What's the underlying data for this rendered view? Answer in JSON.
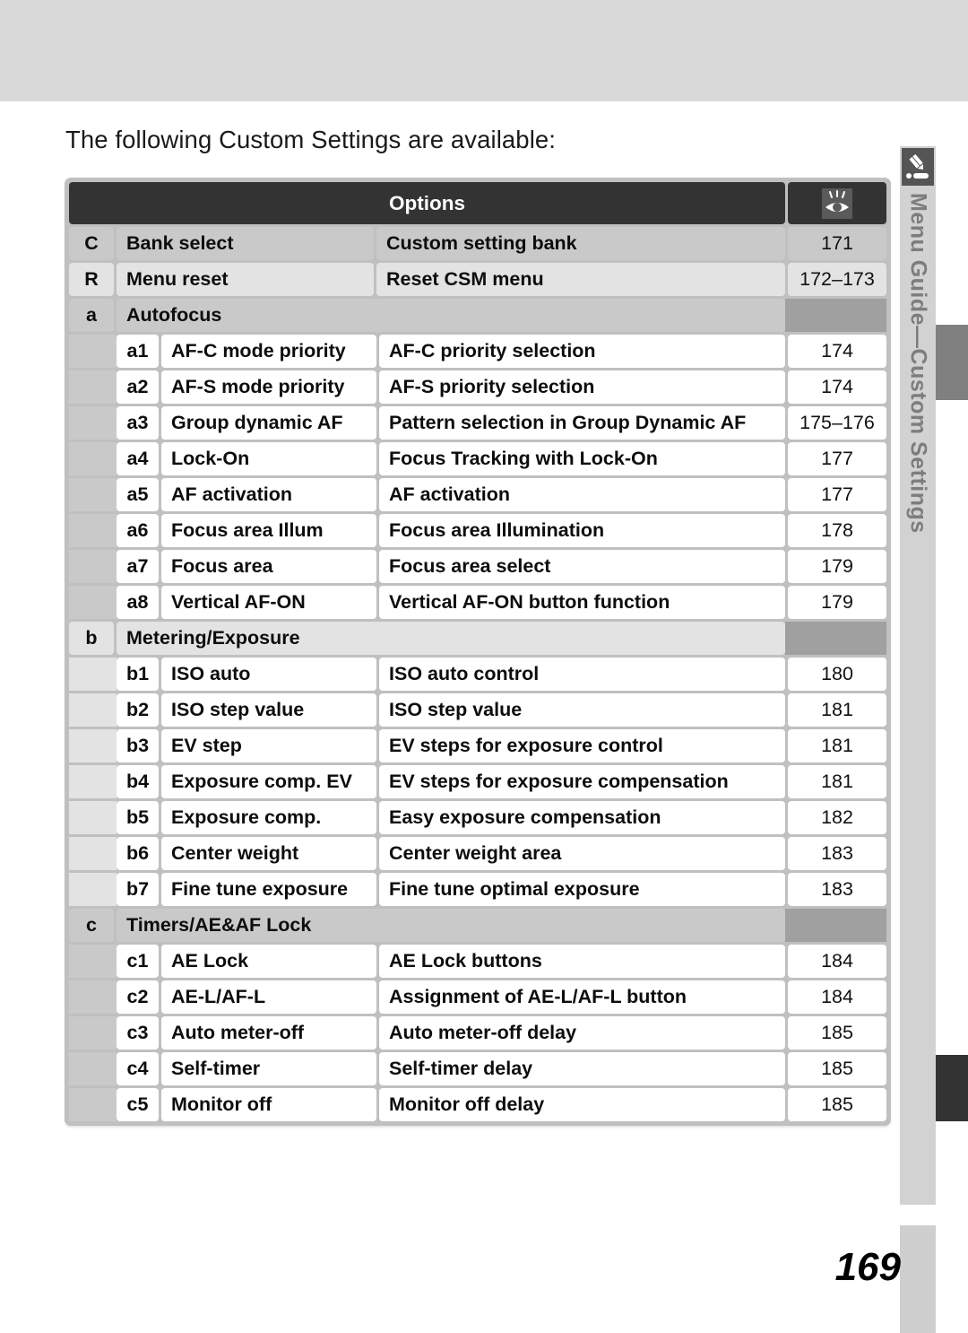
{
  "document": {
    "intro_text": "The following Custom Settings are available:",
    "page_number": "169"
  },
  "side_tab": {
    "label": "Menu Guide—Custom Settings",
    "icon": "pencil-icon"
  },
  "table": {
    "header": {
      "options_label": "Options",
      "page_icon": "eye-reference-icon"
    },
    "top_rows": [
      {
        "index": "C",
        "name": "Bank select",
        "option": "Custom setting bank",
        "page": "171",
        "shade": "sh-dark"
      },
      {
        "index": "R",
        "name": "Menu reset",
        "option": "Reset CSM menu",
        "page": "172–173",
        "shade": "sh-light"
      }
    ],
    "sections": [
      {
        "index": "a",
        "title": "Autofocus",
        "shade": "sh-dark",
        "rows": [
          {
            "sub": "a1",
            "name": "AF-C mode priority",
            "option": "AF-C priority selection",
            "page": "174"
          },
          {
            "sub": "a2",
            "name": "AF-S mode priority",
            "option": "AF-S priority selection",
            "page": "174"
          },
          {
            "sub": "a3",
            "name": "Group dynamic AF",
            "option": "Pattern selection in Group Dynamic AF",
            "page": "175–176"
          },
          {
            "sub": "a4",
            "name": "Lock-On",
            "option": "Focus Tracking with Lock-On",
            "page": "177"
          },
          {
            "sub": "a5",
            "name": "AF activation",
            "option": "AF activation",
            "page": "177"
          },
          {
            "sub": "a6",
            "name": "Focus area Illum",
            "option": "Focus area Illumination",
            "page": "178"
          },
          {
            "sub": "a7",
            "name": "Focus area",
            "option": "Focus area select",
            "page": "179"
          },
          {
            "sub": "a8",
            "name": "Vertical AF-ON",
            "option": "Vertical AF-ON button function",
            "page": "179"
          }
        ]
      },
      {
        "index": "b",
        "title": "Metering/Exposure",
        "shade": "sh-light",
        "rows": [
          {
            "sub": "b1",
            "name": "ISO auto",
            "option": "ISO auto control",
            "page": "180"
          },
          {
            "sub": "b2",
            "name": "ISO step value",
            "option": "ISO step value",
            "page": "181"
          },
          {
            "sub": "b3",
            "name": "EV step",
            "option": "EV steps for exposure control",
            "page": "181"
          },
          {
            "sub": "b4",
            "name": "Exposure comp. EV",
            "option": "EV steps for exposure compensation",
            "page": "181"
          },
          {
            "sub": "b5",
            "name": "Exposure comp.",
            "option": "Easy exposure compensation",
            "page": "182"
          },
          {
            "sub": "b6",
            "name": "Center weight",
            "option": "Center weight area",
            "page": "183"
          },
          {
            "sub": "b7",
            "name": "Fine tune exposure",
            "option": "Fine tune optimal exposure",
            "page": "183"
          }
        ]
      },
      {
        "index": "c",
        "title": "Timers/AE&AF Lock",
        "shade": "sh-dark",
        "rows": [
          {
            "sub": "c1",
            "name": "AE Lock",
            "option": "AE Lock buttons",
            "page": "184"
          },
          {
            "sub": "c2",
            "name": "AE-L/AF-L",
            "option": "Assignment of AE-L/AF-L button",
            "page": "184"
          },
          {
            "sub": "c3",
            "name": "Auto meter-off",
            "option": "Auto meter-off delay",
            "page": "185"
          },
          {
            "sub": "c4",
            "name": "Self-timer",
            "option": "Self-timer delay",
            "page": "185"
          },
          {
            "sub": "c5",
            "name": "Monitor off",
            "option": "Monitor off delay",
            "page": "185"
          }
        ]
      }
    ]
  },
  "colors": {
    "top_band": "#d9d9d9",
    "header_bar": "#333333",
    "shade_dark": "#c9c9c9",
    "shade_light": "#e3e3e3",
    "frame": "#c0c0c0",
    "section_blank": "#a0a0a0",
    "tab_gray": "#d2d2d2",
    "tab_text": "#7d7d7d"
  }
}
